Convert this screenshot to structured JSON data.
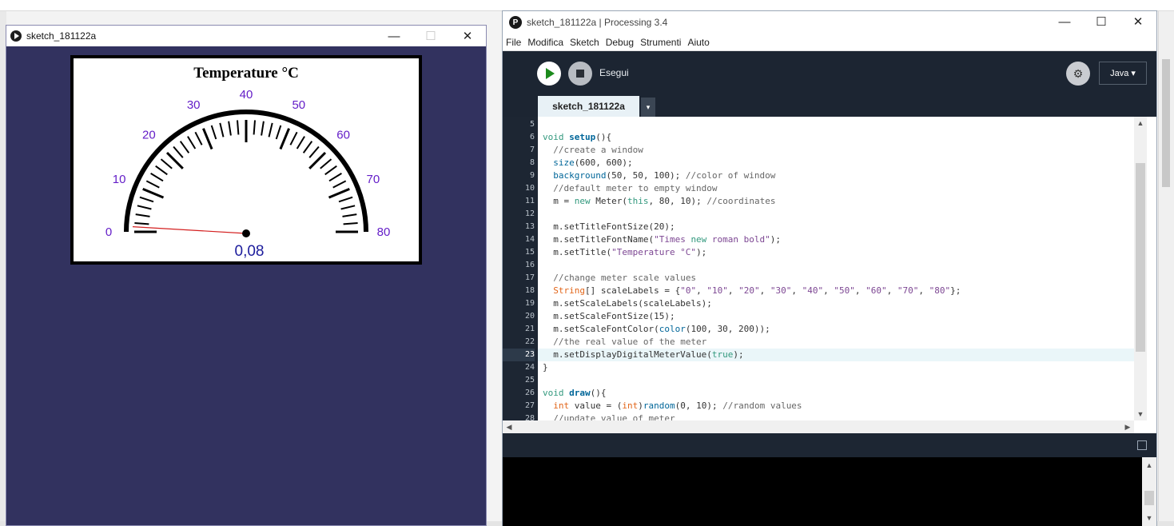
{
  "sketch_window": {
    "title": "sketch_181122a",
    "controls": {
      "minimize": "—",
      "maximize": "☐",
      "close": "✕"
    },
    "meter": {
      "title": "Temperature °C",
      "scale_labels": [
        "0",
        "10",
        "20",
        "30",
        "40",
        "50",
        "60",
        "70",
        "80"
      ],
      "scale_min": 0,
      "scale_max": 80,
      "value": 0.08,
      "digital_readout": "0,08",
      "scale_color": "#641ec8",
      "needle_color": "#d42020",
      "background_color": "#32325f"
    }
  },
  "ide_window": {
    "title": "sketch_181122a | Processing 3.4",
    "logo": "P",
    "controls": {
      "minimize": "—",
      "maximize": "☐",
      "close": "✕"
    },
    "menu": [
      "File",
      "Modifica",
      "Sketch",
      "Debug",
      "Strumenti",
      "Aiuto"
    ],
    "toolbar": {
      "run_label": "Esegui",
      "mode": "Java ▾",
      "debug_icon": "debug-icon"
    },
    "tab": {
      "name": "sketch_181122a",
      "arrow": "▾"
    },
    "code": {
      "line_numbers": [
        "5",
        "6",
        "7",
        "8",
        "9",
        "10",
        "11",
        "12",
        "13",
        "14",
        "15",
        "16",
        "17",
        "18",
        "19",
        "20",
        "21",
        "22",
        "23",
        "24",
        "25",
        "26",
        "27",
        "28"
      ],
      "highlighted_line": "23",
      "lines": [
        "",
        "void setup(){",
        "  //create a window",
        "  size(600, 600);",
        "  background(50, 50, 100); //color of window",
        "  //default meter to empty window",
        "  m = new Meter(this, 80, 10); //coordinates",
        "",
        "  m.setTitleFontSize(20);",
        "  m.setTitleFontName(\"Times new roman bold\");",
        "  m.setTitle(\"Temperature °C\");",
        "",
        "  //change meter scale values",
        "  String[] scaleLabels = {\"0\", \"10\", \"20\", \"30\", \"40\", \"50\", \"60\", \"70\", \"80\"};",
        "  m.setScaleLabels(scaleLabels);",
        "  m.setScaleFontSize(15);",
        "  m.setScaleFontColor(color(100, 30, 200));",
        "  //the real value of the meter",
        "  m.setDisplayDigitalMeterValue(true);",
        "}",
        "",
        "void draw(){",
        "  int value = (int)random(0, 10); //random values",
        "  //update value of meter"
      ]
    },
    "scroll_arrows": {
      "up": "▲",
      "down": "▼",
      "left": "◀",
      "right": "▶"
    }
  }
}
